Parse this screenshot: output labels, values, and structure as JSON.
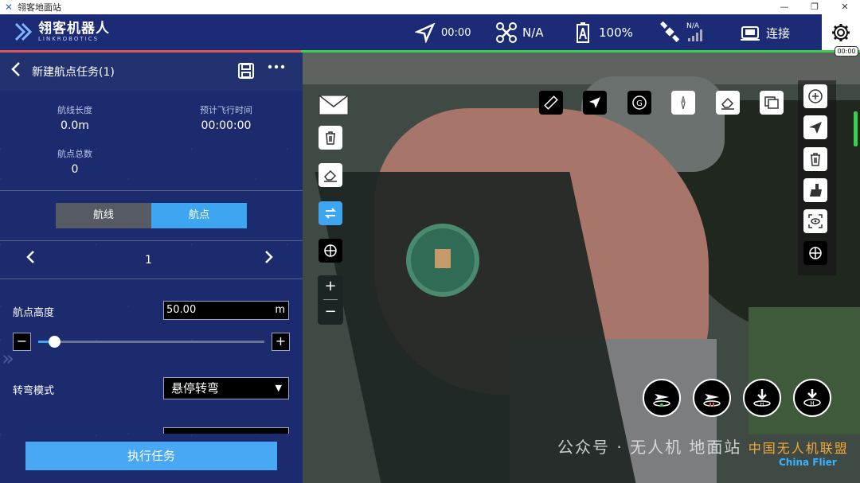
{
  "window": {
    "title": "翎客地面站",
    "controls": {
      "minimize": "—",
      "maximize": "❐",
      "close": "✕"
    }
  },
  "topbar": {
    "logo_cn": "翎客机器人",
    "logo_en": "LINKROBOTICS",
    "flight_time": "00:00",
    "drone_status": "N/A",
    "battery": "100%",
    "gps_label": "N/A",
    "connection": "连接",
    "clock_chip": "00:00"
  },
  "sidebar": {
    "title": "新建航点任务(1)",
    "stats": {
      "route_length_label": "航线长度",
      "route_length_value": "0.0m",
      "est_time_label": "预计飞行时间",
      "est_time_value": "00:00:00",
      "waypoint_count_label": "航点总数",
      "waypoint_count_value": "0"
    },
    "segments": {
      "route": "航线",
      "waypoint": "航点",
      "active": "航点"
    },
    "pager": {
      "current": "1"
    },
    "altitude": {
      "label": "航点高度",
      "value": "50.00",
      "unit": "m",
      "slider_fraction": 0.07
    },
    "turn_mode": {
      "label": "转弯模式",
      "value": "悬停转弯"
    },
    "execute_label": "执行任务"
  },
  "map": {
    "watermark_main": "公众号 · 无人机 地面站",
    "watermark_brand": "中国无人机联盟",
    "watermark_en": "China Flier"
  },
  "colors": {
    "topbar": "#1b2b75",
    "sidebar": "#1c2a6e",
    "accent_blue": "#3ea6f0",
    "status_green": "#3ad14a",
    "status_red": "#e25555"
  }
}
